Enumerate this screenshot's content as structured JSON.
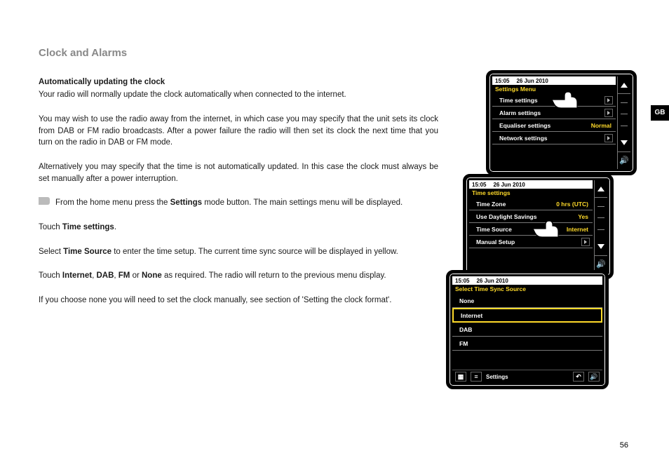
{
  "page": {
    "number": "56",
    "side_tab": "GB"
  },
  "text": {
    "heading": "Clock and Alarms",
    "sub": "Automatically updating the clock",
    "p1": "Your radio will normally update the clock automatically when connected to the internet.",
    "p2": "You may wish to use the radio away from the internet, in which case you may specify that the unit sets its clock from DAB or FM radio broadcasts. After a power failure the radio will then set its clock the next time that you turn on the radio in DAB or FM mode.",
    "p3": "Alternatively you may specify that the time is not automatically updated. In this case the clock must always be set manually after a power interruption.",
    "p4a": "From the home menu press the ",
    "p4b": "Settings",
    "p4c": " mode button. The main settings menu will be displayed.",
    "p5a": "Touch ",
    "p5b": "Time settings",
    "p5c": ".",
    "p6a": "Select ",
    "p6b": "Time Source",
    "p6c": " to enter the time setup. The current time sync source will be displayed in yellow.",
    "p7a": "Touch ",
    "p7b1": "Internet",
    "p7s1": ", ",
    "p7b2": "DAB",
    "p7s2": ", ",
    "p7b3": "FM",
    "p7s3": " or ",
    "p7b4": "None",
    "p7c": " as required. The radio will return to the previous menu display.",
    "p8": "If you choose none you will need to set the clock manually, see section of 'Setting the clock format'."
  },
  "screen1": {
    "status_time": "15:05",
    "status_date": "26 Jun 2010",
    "title": "Settings Menu",
    "rows": [
      {
        "label": "Time settings",
        "chev": true
      },
      {
        "label": "Alarm settings",
        "chev": true
      },
      {
        "label": "Equaliser settings",
        "value": "Normal"
      },
      {
        "label": "Network settings",
        "chev": true
      }
    ]
  },
  "screen2": {
    "status_time": "15:05",
    "status_date": "26 Jun 2010",
    "title": "Time settings",
    "rows": [
      {
        "label": "Time Zone",
        "value": "0 hrs (UTC)"
      },
      {
        "label": "Use Daylight Savings",
        "value": "Yes"
      },
      {
        "label": "Time Source",
        "value": "Internet"
      },
      {
        "label": "Manual Setup",
        "chev": true
      }
    ]
  },
  "screen3": {
    "status_time": "15:05",
    "status_date": "26 Jun 2010",
    "title": "Select Time Sync Source",
    "options": [
      "None",
      "Internet",
      "DAB",
      "FM"
    ],
    "selected_index": 1,
    "bottom_label": "Settings"
  }
}
